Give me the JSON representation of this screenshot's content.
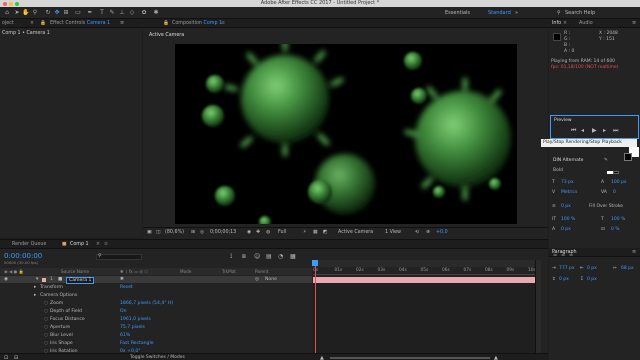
{
  "app": {
    "title": "Adobe After Effects CC 2017 - Untitled Project *"
  },
  "workspace": {
    "essentials": "Essentials",
    "standard": "Standard",
    "search_placeholder": "Search Help"
  },
  "project_panel": {
    "tab": "oject",
    "breadcrumb": "Comp 1 • Camera 1"
  },
  "effect_controls": {
    "tab_prefix": "Effect Controls",
    "tab_layer": "Camera 1"
  },
  "composition": {
    "tab_prefix": "Composition",
    "tab_comp": "Comp 1",
    "layer_label": "Active Camera"
  },
  "viewer_bar": {
    "zoom": "(80,6%)",
    "timecode": "0;00;00;13",
    "resolution": "Full",
    "view": "Active Camera",
    "views": "1 View",
    "exposure": "+0,0"
  },
  "info": {
    "tab_info": "Info",
    "tab_audio": "Audio",
    "r": "R :",
    "g": "G :",
    "b": "B :",
    "a": "A : 0",
    "x": "X : 2048",
    "y": "Y : 151",
    "ram_status": "Playing from RAM: 14 of 600",
    "fps_status": "fps: 01,18/100 (NOT realtime)"
  },
  "preview": {
    "tab": "Preview",
    "tooltip": "Play/Stop Rendering/Stop Playback"
  },
  "character": {
    "font": "DIN Alternate",
    "style": "Bold",
    "size": "73 px",
    "leading": "100 px",
    "tracking": "Metrics",
    "kerning": "0",
    "stroke_width": "0 px",
    "stroke_type": "Fill Over Stroke",
    "vscale": "100 %",
    "hscale": "100 %",
    "baseline": "0 px",
    "tsume": "0 %"
  },
  "paragraph": {
    "tab": "Paragraph",
    "indent_left": "777 px",
    "indent_right": "0 px",
    "indent_first": "68 px",
    "space_before": "0 px",
    "space_after": "0 px"
  },
  "timeline": {
    "tab_render": "Render Queue",
    "tab_comp": "Comp 1",
    "timecode": "0:00:00:00",
    "fps": "00000 (30.00 fps)",
    "headers": {
      "source_name": "Source Name",
      "mode": "Mode",
      "trkmat": "TrkMat",
      "parent": "Parent"
    },
    "layer": {
      "index": "1",
      "name": "Camera 1",
      "parent": "None"
    },
    "properties": [
      {
        "name": "Transform",
        "value": "Reset"
      },
      {
        "name": "Camera Options",
        "value": ""
      },
      {
        "name": "Zoom",
        "value": "1866,7 pixels (54,4° H)"
      },
      {
        "name": "Depth of Field",
        "value": "On"
      },
      {
        "name": "Focus Distance",
        "value": "1961,0 pixels"
      },
      {
        "name": "Aperture",
        "value": "75,7 pixels"
      },
      {
        "name": "Blur Level",
        "value": "61%"
      },
      {
        "name": "Iris Shape",
        "value": "Fast Rectangle"
      },
      {
        "name": "Iris Rotation",
        "value": "0x +0,0°"
      }
    ],
    "ruler": [
      "0s",
      "01s",
      "02s",
      "03s",
      "04s",
      "05s",
      "06s",
      "07s",
      "08s",
      "09s",
      "10s"
    ],
    "toggle_label": "Toggle Switches / Modes"
  },
  "colors": {
    "accent": "#3d9bff",
    "layer_bar": "#e8a9b1",
    "fps_warning": "#e05050",
    "virus": "#4ea04a"
  }
}
